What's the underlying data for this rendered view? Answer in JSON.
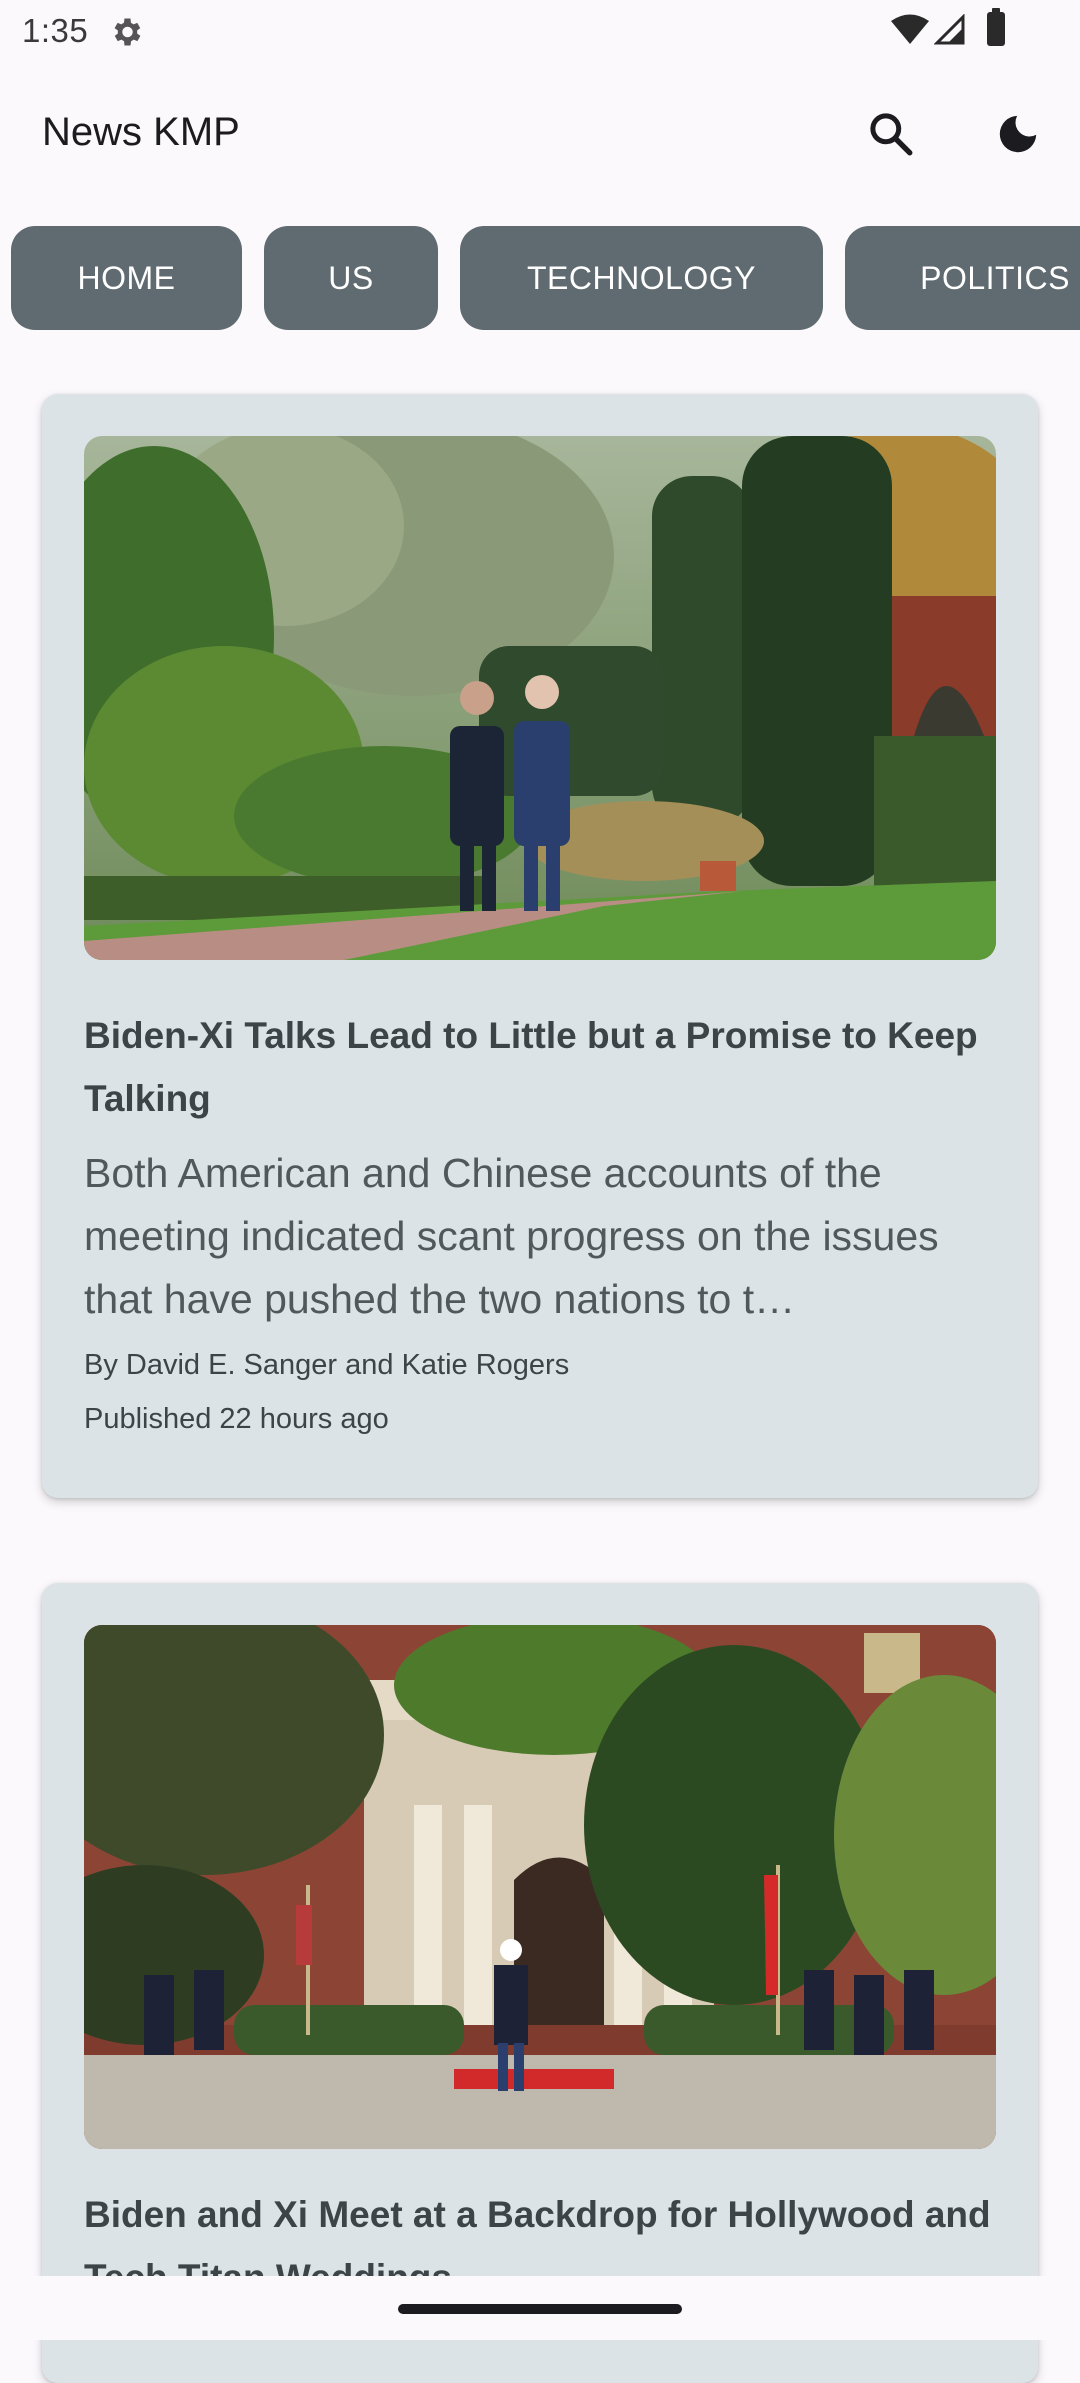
{
  "status_bar": {
    "time": "1:35"
  },
  "app_bar": {
    "title": "News KMP",
    "search_icon": "search-icon",
    "theme_icon": "dark-mode-moon-icon"
  },
  "tabs": [
    {
      "label": "HOME"
    },
    {
      "label": "US"
    },
    {
      "label": "TECHNOLOGY"
    },
    {
      "label": "POLITICS"
    }
  ],
  "articles": [
    {
      "headline": "Biden-Xi Talks Lead to Little but a Promise to Keep Talking",
      "summary": "Both American and Chinese accounts of the meeting indicated scant progress on the issues that have pushed the two nations to t…",
      "byline": "By David E. Sanger and Katie Rogers",
      "published": "Published 22 hours ago"
    },
    {
      "headline": "Biden and Xi Meet at a Backdrop for Hollywood and Tech Titan Weddings"
    }
  ],
  "colors": {
    "tab_background": "#5f6b70",
    "card_background": "#dce3e7",
    "page_background": "#fbf9fc"
  }
}
